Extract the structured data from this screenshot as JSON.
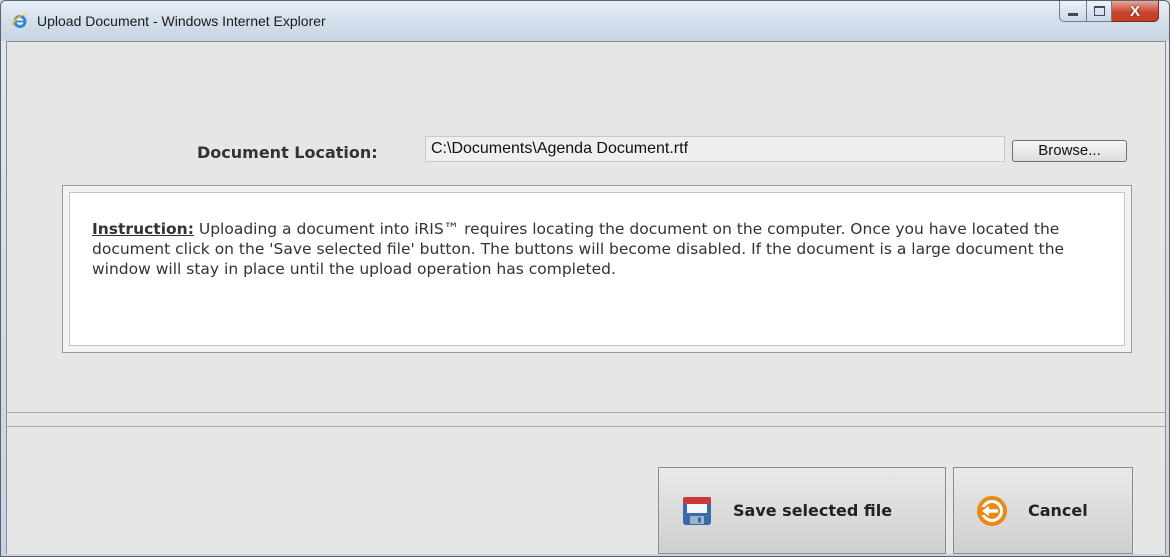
{
  "window": {
    "title": "Upload Document - Windows Internet Explorer",
    "caption_buttons": {
      "minimize_icon": "minimize-icon",
      "maximize_icon": "maximize-icon",
      "close_icon": "close-icon",
      "close_glyph": "X"
    }
  },
  "form": {
    "location_label": "Document Location:",
    "location_value": "C:\\Documents\\Agenda Document.rtf",
    "browse_label": "Browse..."
  },
  "instruction": {
    "heading": "Instruction:",
    "body": " Uploading a document into iRIS™ requires locating the document on the computer. Once you have located the document click on the 'Save selected file' button. The buttons will become disabled. If the document is a large document the window will stay in place until the upload operation has completed."
  },
  "actions": {
    "save_label": "Save selected file",
    "save_icon": "floppy-disk-icon",
    "cancel_label": "Cancel",
    "cancel_icon": "cancel-undo-icon"
  },
  "colors": {
    "panel_bg": "#e6e6e6",
    "cancel_icon_orange": "#e98a16",
    "save_icon_blue": "#3b6aa8",
    "close_button_red": "#c9472f"
  }
}
